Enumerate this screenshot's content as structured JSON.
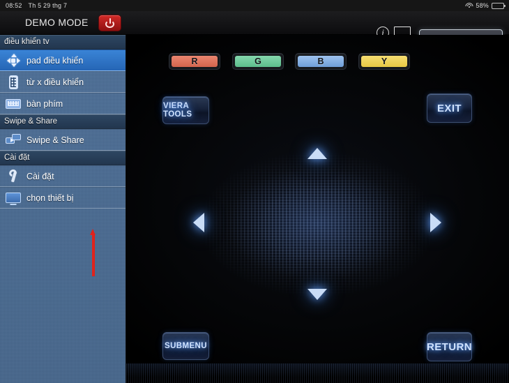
{
  "statusbar": {
    "time": "08:52",
    "date": "Th 5 29 thg 7",
    "battery_percent": "58%",
    "wifi_icon": "wifi-icon",
    "battery_icon": "battery-icon"
  },
  "header": {
    "title": "DEMO MODE",
    "power_icon": "power-icon",
    "info_icon": "info-icon",
    "info_glyph": "i",
    "device_icon": "device-monitor-icon",
    "device_nomark": "✕"
  },
  "sidebar": {
    "sections": [
      {
        "title": "điều khiển tv",
        "items": [
          {
            "label": "pad điều khiển",
            "icon": "dpad-icon",
            "selected": true
          },
          {
            "label": "từ x điều khiển",
            "icon": "remote-icon",
            "selected": false
          },
          {
            "label": "bàn phím",
            "icon": "keyboard-icon",
            "selected": false
          }
        ]
      },
      {
        "title": "Swipe & Share",
        "items": [
          {
            "label": "Swipe & Share",
            "icon": "swipe-share-icon",
            "selected": false
          }
        ]
      },
      {
        "title": "Cài đặt",
        "items": [
          {
            "label": "Cài đặt",
            "icon": "wrench-icon",
            "selected": false
          },
          {
            "label": "chọn thiết bị",
            "icon": "tv-icon",
            "selected": false
          }
        ]
      }
    ],
    "annotation": {
      "name": "red-arrow-annotation",
      "color": "#e0231c"
    }
  },
  "remote": {
    "color_buttons": [
      {
        "label": "R",
        "color": "#d4644c"
      },
      {
        "label": "G",
        "color": "#5cbd8c"
      },
      {
        "label": "B",
        "color": "#6f9ed8"
      },
      {
        "label": "Y",
        "color": "#e8c944"
      }
    ],
    "viera_tools_label": "VIERA TOOLS",
    "exit_label": "EXIT",
    "submenu_label": "SUBMENU",
    "return_label": "RETURN",
    "dpad": {
      "up_icon": "arrow-up-icon",
      "down_icon": "arrow-down-icon",
      "left_icon": "arrow-left-icon",
      "right_icon": "arrow-right-icon"
    }
  },
  "preview": {
    "name": "tv-preview-panel"
  },
  "colors": {
    "accent_blue": "#2565b5",
    "sidebar_blue": "#4a6c94",
    "power_red": "#d02a27",
    "glow_blue": "#6ea6ff"
  }
}
